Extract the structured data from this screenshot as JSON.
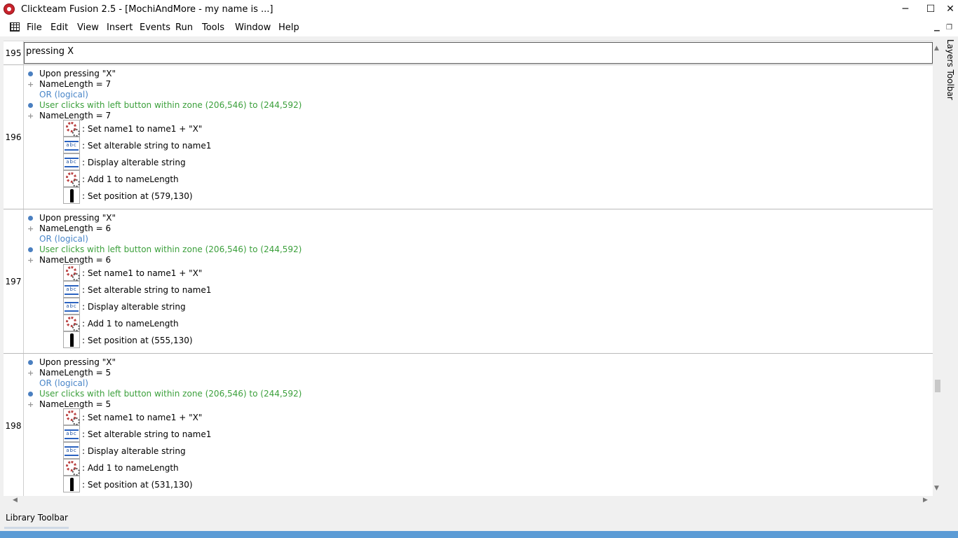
{
  "window": {
    "title": "Clickteam Fusion 2.5 - [MochiAndMore - my name is ...]",
    "minimize_glyph": "─",
    "maximize_glyph": "☐",
    "close_glyph": "✕"
  },
  "menu": {
    "items": [
      "File",
      "Edit",
      "View",
      "Insert",
      "Events",
      "Run",
      "Tools",
      "Window",
      "Help"
    ],
    "mdi_min_glyph": "▁",
    "mdi_restore_glyph": "❐"
  },
  "editor": {
    "comment_row": {
      "number": "195",
      "text": "pressing X"
    },
    "events": [
      {
        "number": "196",
        "conditions": [
          {
            "kind": "bullet",
            "style": "normal",
            "text": "Upon pressing \"X\""
          },
          {
            "kind": "plus",
            "style": "normal",
            "text": "NameLength = 7"
          },
          {
            "kind": "none",
            "style": "blue",
            "text": "OR (logical)"
          },
          {
            "kind": "bullet",
            "style": "green",
            "text": "User clicks with left button within zone (206,546) to (244,592)"
          },
          {
            "kind": "plus",
            "style": "normal",
            "text": "NameLength = 7"
          }
        ],
        "actions": [
          {
            "icon": "gears-icon",
            "text": ": Set name1 to name1 + \"X\""
          },
          {
            "icon": "string-object-icon",
            "text": ": Set alterable string to name1"
          },
          {
            "icon": "string-object-icon",
            "text": ": Display alterable string"
          },
          {
            "icon": "gears-icon",
            "text": ": Add 1 to nameLength"
          },
          {
            "icon": "active-object-icon",
            "text": ": Set position at (579,130)"
          }
        ]
      },
      {
        "number": "197",
        "conditions": [
          {
            "kind": "bullet",
            "style": "normal",
            "text": "Upon pressing \"X\""
          },
          {
            "kind": "plus",
            "style": "normal",
            "text": "NameLength = 6"
          },
          {
            "kind": "none",
            "style": "blue",
            "text": "OR (logical)"
          },
          {
            "kind": "bullet",
            "style": "green",
            "text": "User clicks with left button within zone (206,546) to (244,592)"
          },
          {
            "kind": "plus",
            "style": "normal",
            "text": "NameLength = 6"
          }
        ],
        "actions": [
          {
            "icon": "gears-icon",
            "text": ": Set name1 to name1 + \"X\""
          },
          {
            "icon": "string-object-icon",
            "text": ": Set alterable string to name1"
          },
          {
            "icon": "string-object-icon",
            "text": ": Display alterable string"
          },
          {
            "icon": "gears-icon",
            "text": ": Add 1 to nameLength"
          },
          {
            "icon": "active-object-icon",
            "text": ": Set position at (555,130)"
          }
        ]
      },
      {
        "number": "198",
        "conditions": [
          {
            "kind": "bullet",
            "style": "normal",
            "text": "Upon pressing \"X\""
          },
          {
            "kind": "plus",
            "style": "normal",
            "text": "NameLength = 5"
          },
          {
            "kind": "none",
            "style": "blue",
            "text": "OR (logical)"
          },
          {
            "kind": "bullet",
            "style": "green",
            "text": "User clicks with left button within zone (206,546) to (244,592)"
          },
          {
            "kind": "plus",
            "style": "normal",
            "text": "NameLength = 5"
          }
        ],
        "actions": [
          {
            "icon": "gears-icon",
            "text": ": Set name1 to name1 + \"X\""
          },
          {
            "icon": "string-object-icon",
            "text": ": Set alterable string to name1"
          },
          {
            "icon": "string-object-icon",
            "text": ": Display alterable string"
          },
          {
            "icon": "gears-icon",
            "text": ": Add 1 to nameLength"
          },
          {
            "icon": "active-object-icon",
            "text": ": Set position at (531,130)"
          }
        ]
      }
    ]
  },
  "side_panels": {
    "layers_toolbar": "Layers Toolbar",
    "library_toolbar": "Library Toolbar"
  },
  "scroll_glyphs": {
    "up": "▲",
    "down": "▼",
    "left": "◀",
    "right": "▶"
  },
  "colors": {
    "condition_green": "#3ca03c",
    "logical_or_blue": "#4a86c8",
    "status_bar_blue": "#5b9bd5"
  }
}
